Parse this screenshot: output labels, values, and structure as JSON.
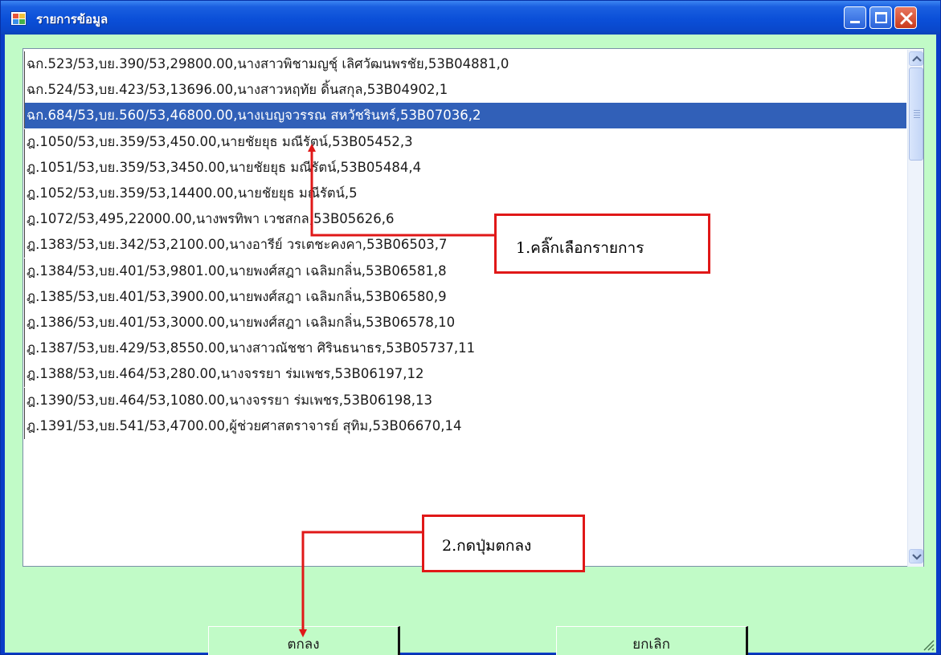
{
  "window": {
    "title": "รายการข้อมูล"
  },
  "list": {
    "selected_index": 2,
    "items": [
      "ฉก.523/53,บย.390/53,29800.00,นางสาวพิชามญชุ์ เลิศวัฒนพรชัย,53B04881,0",
      "ฉก.524/53,บย.423/53,13696.00,นางสาวหฤทัย ดิ้นสกุล,53B04902,1",
      "ฉก.684/53,บย.560/53,46800.00,นางเบญจวรรณ สหวัชรินทร์,53B07036,2",
      "ฎ.1050/53,บย.359/53,450.00,นายชัยยุธ มณีรัตน์,53B05452,3",
      "ฎ.1051/53,บย.359/53,3450.00,นายชัยยุธ มณีรัตน์,53B05484,4",
      "ฎ.1052/53,บย.359/53,14400.00,นายชัยยุธ มณีรัตน์,5",
      "ฎ.1072/53,495,22000.00,นางพรทิพา เวชสกล,53B05626,6",
      "ฎ.1383/53,บย.342/53,2100.00,นางอารีย์ วรเตชะคงคา,53B06503,7",
      "ฎ.1384/53,บย.401/53,9801.00,นายพงศ์สฎา เฉลิมกลิ่น,53B06581,8",
      "ฎ.1385/53,บย.401/53,3900.00,นายพงศ์สฎา เฉลิมกลิ่น,53B06580,9",
      "ฎ.1386/53,บย.401/53,3000.00,นายพงศ์สฎา เฉลิมกลิ่น,53B06578,10",
      "ฎ.1387/53,บย.429/53,8550.00,นางสาวณัชชา ศิรินธนาธร,53B05737,11",
      "ฎ.1388/53,บย.464/53,280.00,นางจรรยา ร่มเพชร,53B06197,12",
      "ฎ.1390/53,บย.464/53,1080.00,นางจรรยา ร่มเพชร,53B06198,13",
      "ฎ.1391/53,บย.541/53,4700.00,ผู้ช่วยศาสตราจารย์ สุทิม,53B06670,14"
    ]
  },
  "buttons": {
    "ok_label": "ตกลง",
    "cancel_label": "ยกเลิก"
  },
  "annotations": {
    "step1": "1.คลิ๊กเลือกรายการ",
    "step2": "2.กดปุ่มตกลง"
  },
  "colors": {
    "titlebar": "#0b4fd8",
    "client_bg": "#c1fbc7",
    "selection": "#3160b8",
    "annotation_border": "#e01818"
  },
  "icons": {
    "app": "app-grid-icon",
    "minimize": "minimize-icon",
    "maximize": "maximize-icon",
    "close": "close-icon",
    "scroll_up": "chevron-up-icon",
    "scroll_down": "chevron-down-icon"
  }
}
